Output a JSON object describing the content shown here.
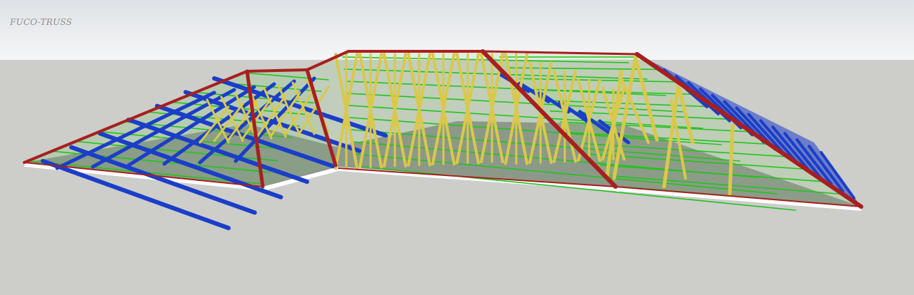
{
  "app": {
    "watermark": "FUCO-TRUSS"
  },
  "colors": {
    "ground": "#cdcdca",
    "slab": "#8e8e8e",
    "slab_edge": "#ffffff",
    "hip_rafter": "#a81f1f",
    "truss": "#d9c84a",
    "batten": "#22c31f",
    "purlin": "#1a3ec8",
    "purlin_fill": "#1a34b8"
  },
  "scene": {
    "model": "3d-roof-truss-model",
    "icons": [
      "roof-truss-icon"
    ]
  }
}
